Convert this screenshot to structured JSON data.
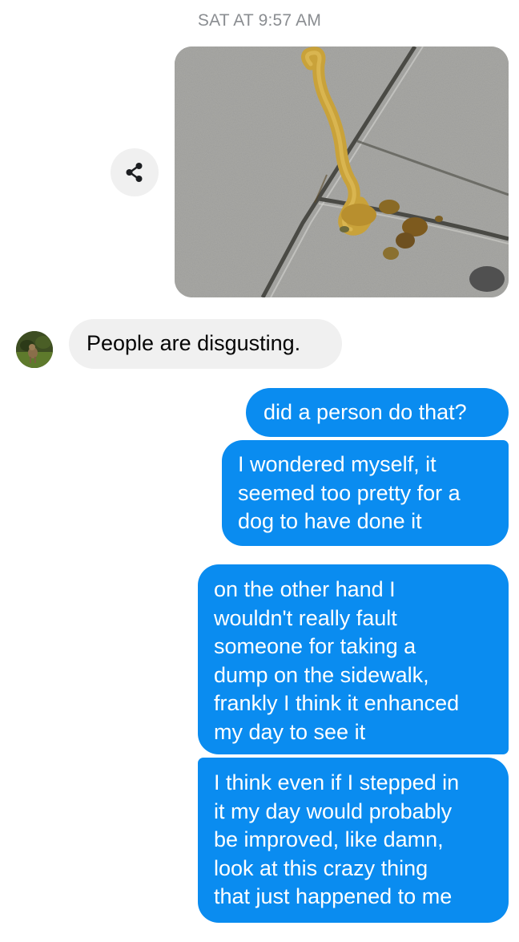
{
  "timestamp": "SAT AT 9:57 AM",
  "photo": {
    "subject": "sidewalk-photo"
  },
  "share_icon": "share-icon",
  "avatar_icon": "contact-avatar",
  "messages": {
    "incoming_1": "People are disgusting.",
    "outgoing_1": "did a person do that?",
    "outgoing_2": {
      "line1": "I wondered myself, it",
      "line2": "seemed too pretty for a",
      "line3": "dog to have done it"
    },
    "outgoing_3": {
      "line1": "on the other hand I",
      "line2": "wouldn't really fault",
      "line3": "someone for taking a",
      "line4": "dump on the sidewalk,",
      "line5": "frankly I think it enhanced",
      "line6": "my day to see it"
    },
    "outgoing_4": {
      "line1": "I think even if I stepped in",
      "line2": "it my day would probably",
      "line3": "be improved, like damn,",
      "line4": "look at this crazy thing",
      "line5": "that just happened to me"
    }
  },
  "colors": {
    "outgoing_bubble": "#0a8cf0",
    "incoming_bubble": "#f0f0f0",
    "timestamp": "#8a8d91"
  }
}
